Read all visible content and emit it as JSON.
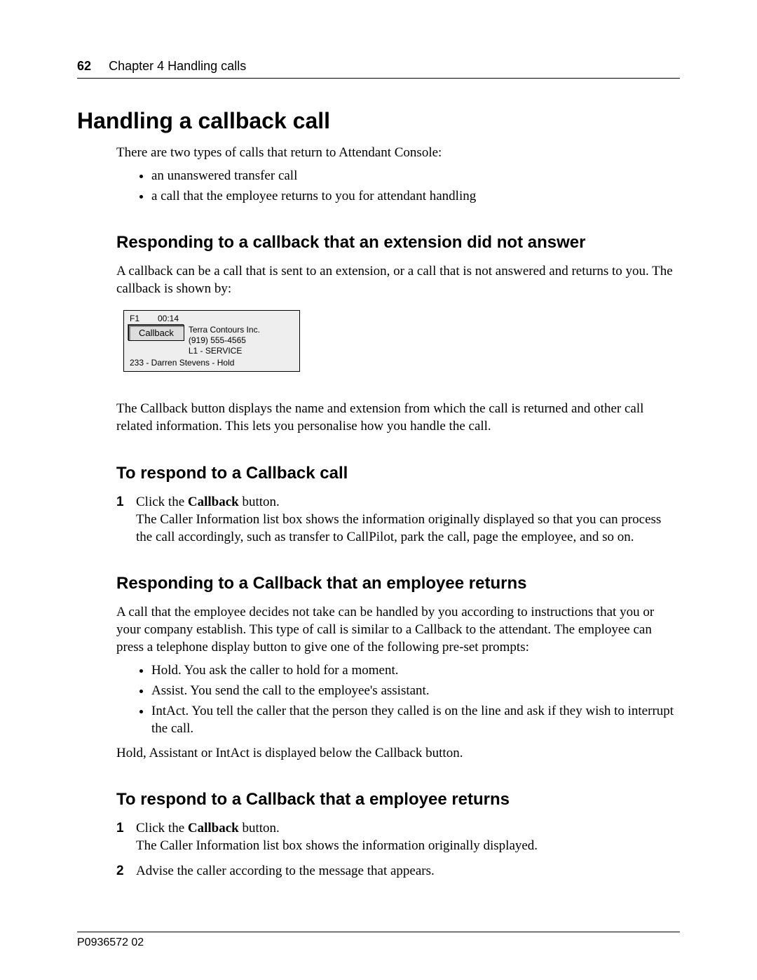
{
  "header": {
    "page_number": "62",
    "chapter": "Chapter 4  Handling calls"
  },
  "h1": "Handling a callback call",
  "intro_line": "There are two types of calls that return to Attendant Console:",
  "intro_bullets": [
    "an unanswered transfer call",
    "a call that the employee returns to you for attendant handling"
  ],
  "sec1": {
    "heading": "Responding to a callback that an extension did not answer",
    "para1": "A callback can be a call that is sent to an extension, or a call that is not answered and returns to you. The callback is shown by:",
    "callback_box": {
      "f1": "F1",
      "time": "00:14",
      "button_label": "Callback",
      "company": "Terra Contours Inc.",
      "phone": "(919) 555-4565",
      "line": "L1 - SERVICE",
      "bottom": "233 - Darren Stevens - Hold"
    },
    "para2": "The Callback button displays the name and extension from which the call is returned and other call related information. This lets you personalise how you handle the call."
  },
  "sec2": {
    "heading": "To respond to a Callback call",
    "step1_prefix": "Click the ",
    "step1_bold": "Callback",
    "step1_suffix": " button.",
    "step1_body": "The Caller Information list box shows the information originally displayed so that you can process the call accordingly, such as transfer to CallPilot, park the call, page the employee, and so on."
  },
  "sec3": {
    "heading": "Responding to a Callback that an employee returns",
    "para1": "A call that the employee decides not take can be handled by you according to instructions that you or your company establish. This type of call is similar to a Callback to the attendant. The employee can press a telephone display button to give one of the following pre-set prompts:",
    "bullets": [
      "Hold. You ask the caller to hold for a moment.",
      "Assist. You send the call to the employee's assistant.",
      "IntAct. You tell the caller that the person they called is on the line and ask if they wish to interrupt the call."
    ],
    "para2": "Hold, Assistant or IntAct is displayed below the Callback button."
  },
  "sec4": {
    "heading": "To respond to a Callback that a employee returns",
    "step1_prefix": "Click the ",
    "step1_bold": "Callback",
    "step1_suffix": " button.",
    "step1_body": "The Caller Information list box shows the information originally displayed.",
    "step2": "Advise the caller according to the message that appears."
  },
  "footer": "P0936572 02"
}
